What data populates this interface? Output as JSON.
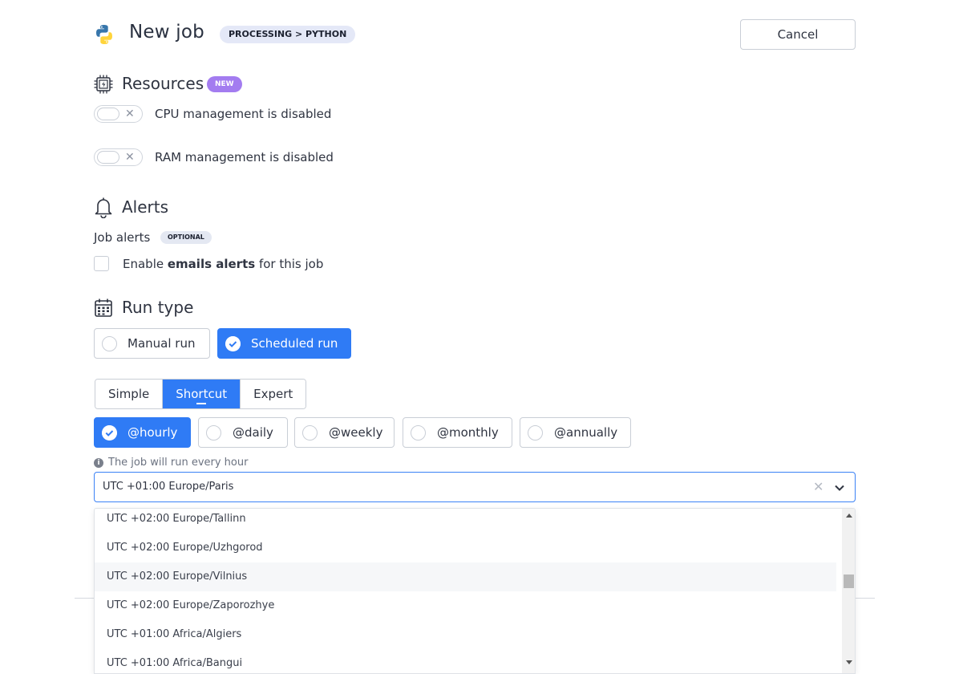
{
  "header": {
    "title": "New job",
    "breadcrumb": "PROCESSING > PYTHON",
    "cancel_label": "Cancel"
  },
  "resources": {
    "title": "Resources",
    "badge": "NEW",
    "cpu_label": "CPU management is disabled",
    "ram_label": "RAM management is disabled"
  },
  "alerts": {
    "title": "Alerts",
    "job_alerts_label": "Job alerts",
    "optional_badge": "OPTIONAL",
    "enable_prefix": "Enable",
    "enable_bold": "emails alerts",
    "enable_suffix": "for this job"
  },
  "run_type": {
    "title": "Run type",
    "manual_label": "Manual run",
    "scheduled_label": "Scheduled run",
    "selected": "Scheduled run"
  },
  "schedule_mode": {
    "tabs": [
      "Simple",
      "Shortcut",
      "Expert"
    ],
    "active": "Shortcut"
  },
  "shortcuts": {
    "options": [
      "@hourly",
      "@daily",
      "@weekly",
      "@monthly",
      "@annually"
    ],
    "selected": "@hourly",
    "hint": "The job will run every hour"
  },
  "timezone": {
    "value": "UTC +01:00 Europe/Paris",
    "options": [
      "UTC +02:00 Europe/Tallinn",
      "UTC +02:00 Europe/Uzhgorod",
      "UTC +02:00 Europe/Vilnius",
      "UTC +02:00 Europe/Zaporozhye",
      "UTC +01:00 Africa/Algiers",
      "UTC +01:00 Africa/Bangui"
    ],
    "highlighted": "UTC +02:00 Europe/Vilnius"
  },
  "colors": {
    "accent": "#2f7bf5",
    "new_badge": "#a37cf0",
    "breadcrumb_bg": "#e4e8f7"
  }
}
